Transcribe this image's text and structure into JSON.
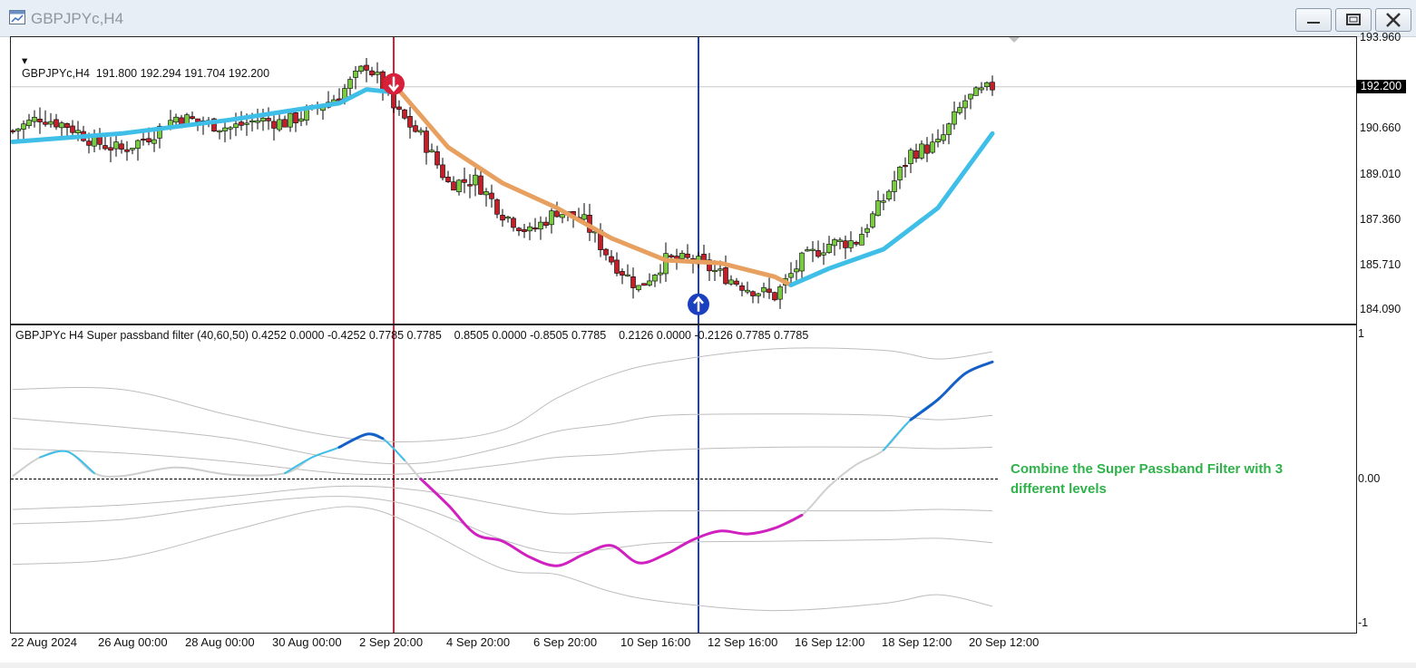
{
  "window": {
    "title": "GBPJPYc,H4",
    "buttons": [
      "minimize",
      "maximize",
      "close"
    ]
  },
  "main_chart": {
    "header": "GBPJPYc,H4  191.800 192.294 191.704 192.200",
    "current_price": "192.200",
    "price_axis_labels": [
      "193.960",
      "190.660",
      "189.010",
      "187.360",
      "185.710",
      "184.090"
    ]
  },
  "indicator": {
    "header": "GBPJPYc H4 Super passband filter (40,60,50) 0.4252 0.0000 -0.4252 0.7785 0.7785    0.8505 0.0000 -0.8505 0.7785    0.2126 0.0000 -0.2126 0.7785 0.7785",
    "axis_labels": [
      "1",
      "0.00",
      "-1"
    ],
    "annotation_line1": "Combine the Super Passband Filter with 3",
    "annotation_line2": "different levels"
  },
  "x_axis_labels": [
    "22 Aug 2024",
    "26 Aug 00:00",
    "28 Aug 00:00",
    "30 Aug 00:00",
    "2 Sep 20:00",
    "4 Sep 20:00",
    "6 Sep 20:00",
    "10 Sep 16:00",
    "12 Sep 16:00",
    "16 Sep 12:00",
    "18 Sep 12:00",
    "20 Sep 12:00"
  ],
  "colors": {
    "bull": "#7ac943",
    "bear": "#c0202a",
    "ma_up": "#3fbfe8",
    "ma_down": "#e8a060",
    "sell_signal": "#d8203a",
    "buy_signal": "#1a40c0",
    "filter_up": "#1560c8",
    "filter_down": "#d020c0",
    "annotation": "#2fb24a"
  },
  "chart_data": [
    {
      "type": "candlestick",
      "title": "GBPJPYc,H4",
      "x_range": [
        "22 Aug 2024",
        "20 Sep 2024"
      ],
      "ylim": [
        183.6,
        194.0
      ],
      "price_levels": [
        193.96,
        190.66,
        189.01,
        187.36,
        185.71,
        184.09
      ],
      "last": {
        "open": 191.8,
        "high": 192.294,
        "low": 191.704,
        "close": 192.2
      },
      "close_path": [
        [
          0,
          190.6
        ],
        [
          5,
          191.1
        ],
        [
          10,
          190.8
        ],
        [
          15,
          190.2
        ],
        [
          20,
          189.9
        ],
        [
          25,
          190.4
        ],
        [
          30,
          191.1
        ],
        [
          35,
          190.9
        ],
        [
          40,
          190.7
        ],
        [
          45,
          191.0
        ],
        [
          50,
          190.9
        ],
        [
          55,
          191.3
        ],
        [
          60,
          191.9
        ],
        [
          65,
          193.0
        ],
        [
          67,
          192.5
        ],
        [
          70,
          191.4
        ],
        [
          75,
          190.4
        ],
        [
          80,
          188.7
        ],
        [
          85,
          188.8
        ],
        [
          90,
          187.6
        ],
        [
          95,
          186.9
        ],
        [
          100,
          187.7
        ],
        [
          105,
          187.3
        ],
        [
          110,
          185.9
        ],
        [
          115,
          184.9
        ],
        [
          120,
          185.9
        ],
        [
          125,
          185.9
        ],
        [
          130,
          185.4
        ],
        [
          135,
          184.9
        ],
        [
          140,
          184.6
        ],
        [
          145,
          185.9
        ],
        [
          150,
          186.5
        ],
        [
          155,
          186.6
        ],
        [
          160,
          188.1
        ],
        [
          165,
          189.8
        ],
        [
          170,
          190.1
        ],
        [
          175,
          191.7
        ],
        [
          180,
          192.2
        ]
      ],
      "ma_fast": [
        [
          0,
          190.2
        ],
        [
          20,
          190.5
        ],
        [
          40,
          191.0
        ],
        [
          60,
          191.6
        ],
        [
          65,
          192.1
        ],
        [
          70,
          192.0
        ]
      ],
      "ma_slow_down": [
        [
          70,
          192.3
        ],
        [
          80,
          190.0
        ],
        [
          90,
          188.7
        ],
        [
          100,
          187.8
        ],
        [
          110,
          186.7
        ],
        [
          120,
          185.9
        ],
        [
          130,
          185.8
        ],
        [
          140,
          185.3
        ],
        [
          143,
          185.0
        ]
      ],
      "ma_fast_up": [
        [
          143,
          185.0
        ],
        [
          150,
          185.6
        ],
        [
          160,
          186.3
        ],
        [
          170,
          187.8
        ],
        [
          180,
          190.5
        ]
      ],
      "signals": [
        {
          "type": "sell",
          "x": 70,
          "price": 192.3
        },
        {
          "type": "buy",
          "x": 126,
          "price": 184.3
        }
      ]
    },
    {
      "type": "line",
      "title": "Super passband filter (40,60,50)",
      "ylim": [
        -1,
        1
      ],
      "zero_line": 0.0,
      "series": [
        {
          "values": [
            [
              0,
              0.02
            ],
            [
              5,
              0.15
            ],
            [
              10,
              0.19
            ],
            [
              15,
              0.04
            ],
            [
              20,
              0.02
            ],
            [
              30,
              0.08
            ],
            [
              40,
              0.03
            ],
            [
              50,
              0.04
            ],
            [
              55,
              0.15
            ],
            [
              60,
              0.22
            ],
            [
              65,
              0.31
            ],
            [
              68,
              0.28
            ],
            [
              72,
              0.13
            ],
            [
              75,
              0.0
            ],
            [
              80,
              -0.18
            ],
            [
              85,
              -0.38
            ],
            [
              90,
              -0.43
            ],
            [
              95,
              -0.54
            ],
            [
              100,
              -0.6
            ],
            [
              105,
              -0.52
            ],
            [
              110,
              -0.46
            ],
            [
              115,
              -0.58
            ],
            [
              120,
              -0.52
            ],
            [
              125,
              -0.42
            ],
            [
              130,
              -0.36
            ],
            [
              135,
              -0.38
            ],
            [
              140,
              -0.34
            ],
            [
              145,
              -0.25
            ],
            [
              150,
              -0.05
            ],
            [
              155,
              0.1
            ],
            [
              160,
              0.2
            ],
            [
              165,
              0.41
            ],
            [
              170,
              0.55
            ],
            [
              175,
              0.73
            ],
            [
              180,
              0.81
            ]
          ]
        },
        {
          "values": [
            [
              0,
              0.62
            ],
            [
              20,
              0.62
            ],
            [
              40,
              0.44
            ],
            [
              60,
              0.29
            ],
            [
              75,
              0.26
            ],
            [
              90,
              0.34
            ],
            [
              100,
              0.56
            ],
            [
              110,
              0.72
            ],
            [
              120,
              0.81
            ],
            [
              140,
              0.9
            ],
            [
              160,
              0.89
            ],
            [
              170,
              0.83
            ],
            [
              180,
              0.88
            ]
          ]
        },
        {
          "values": [
            [
              0,
              0.42
            ],
            [
              20,
              0.36
            ],
            [
              40,
              0.28
            ],
            [
              60,
              0.14
            ],
            [
              75,
              0.11
            ],
            [
              90,
              0.22
            ],
            [
              100,
              0.33
            ],
            [
              110,
              0.38
            ],
            [
              120,
              0.44
            ],
            [
              140,
              0.45
            ],
            [
              160,
              0.44
            ],
            [
              170,
              0.41
            ],
            [
              180,
              0.44
            ]
          ]
        },
        {
          "values": [
            [
              0,
              0.21
            ],
            [
              20,
              0.18
            ],
            [
              40,
              0.12
            ],
            [
              60,
              0.04
            ],
            [
              75,
              0.04
            ],
            [
              90,
              0.1
            ],
            [
              100,
              0.15
            ],
            [
              110,
              0.17
            ],
            [
              120,
              0.2
            ],
            [
              140,
              0.22
            ],
            [
              160,
              0.22
            ],
            [
              170,
              0.21
            ],
            [
              180,
              0.22
            ]
          ]
        },
        {
          "values": [
            [
              0,
              -0.21
            ],
            [
              20,
              -0.18
            ],
            [
              40,
              -0.12
            ],
            [
              60,
              -0.05
            ],
            [
              75,
              -0.08
            ],
            [
              90,
              -0.18
            ],
            [
              100,
              -0.24
            ],
            [
              110,
              -0.23
            ],
            [
              120,
              -0.22
            ],
            [
              140,
              -0.22
            ],
            [
              160,
              -0.22
            ],
            [
              170,
              -0.21
            ],
            [
              180,
              -0.22
            ]
          ]
        },
        {
          "values": [
            [
              0,
              -0.31
            ],
            [
              20,
              -0.28
            ],
            [
              40,
              -0.18
            ],
            [
              60,
              -0.12
            ],
            [
              75,
              -0.2
            ],
            [
              90,
              -0.42
            ],
            [
              100,
              -0.51
            ],
            [
              110,
              -0.48
            ],
            [
              120,
              -0.44
            ],
            [
              140,
              -0.43
            ],
            [
              160,
              -0.42
            ],
            [
              170,
              -0.41
            ],
            [
              180,
              -0.44
            ]
          ]
        },
        {
          "values": [
            [
              0,
              -0.59
            ],
            [
              20,
              -0.55
            ],
            [
              40,
              -0.36
            ],
            [
              55,
              -0.22
            ],
            [
              65,
              -0.2
            ],
            [
              75,
              -0.34
            ],
            [
              90,
              -0.62
            ],
            [
              100,
              -0.66
            ],
            [
              110,
              -0.78
            ],
            [
              120,
              -0.85
            ],
            [
              140,
              -0.91
            ],
            [
              160,
              -0.86
            ],
            [
              170,
              -0.8
            ],
            [
              180,
              -0.88
            ]
          ]
        }
      ]
    }
  ]
}
